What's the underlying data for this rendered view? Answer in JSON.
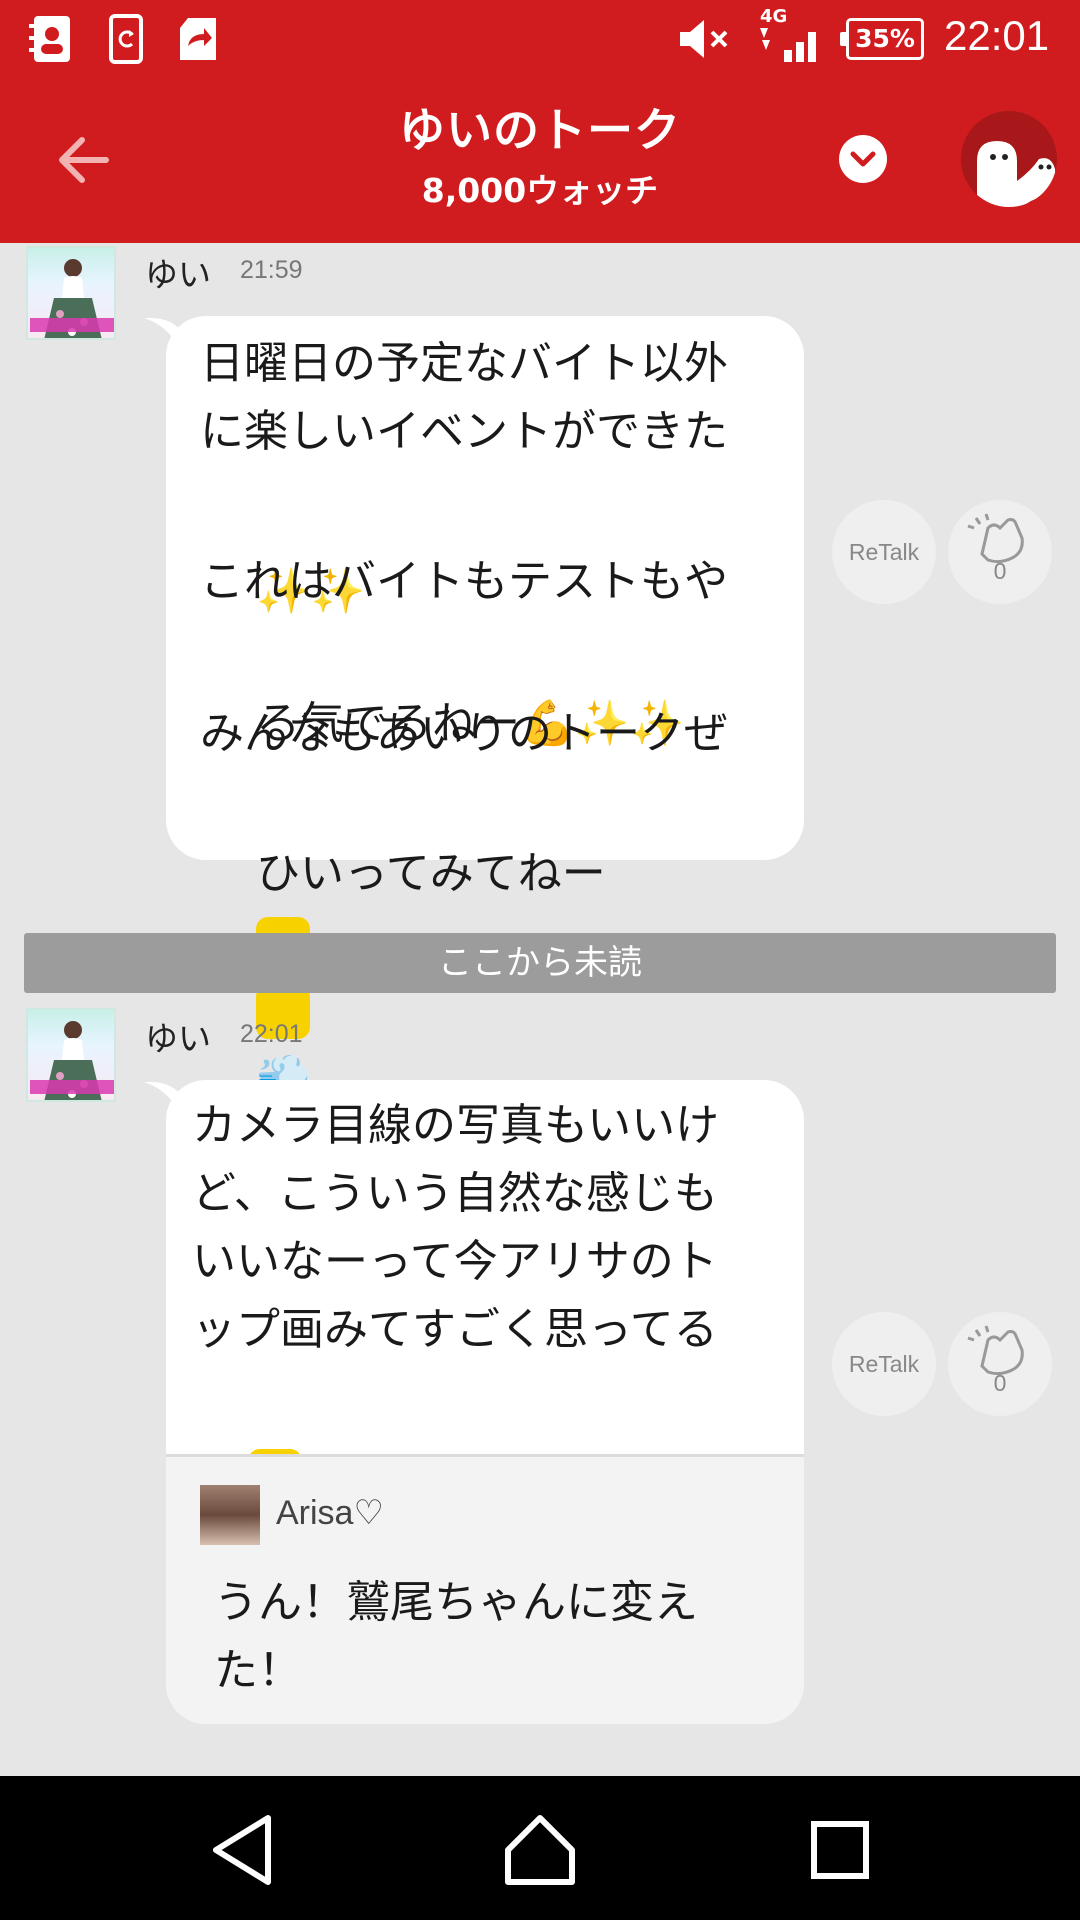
{
  "status_bar": {
    "battery": "35%",
    "time": "22:01",
    "network": "4G"
  },
  "header": {
    "title": "ゆいのトーク",
    "subtitle": "8,000ウォッチ"
  },
  "messages": [
    {
      "sender": "ゆい",
      "time": "21:59",
      "text_lines": [
        "日曜日の予定なバイト以外",
        "に楽しいイベントができた",
        "",
        "これはバイトもテストもや",
        "る気でるねー",
        "みんなもあいりのトークぜ",
        "ひいってみてねー"
      ],
      "retalk_label": "ReTalk",
      "clap_count": "0"
    },
    {
      "sender": "ゆい",
      "time": "22:01",
      "text_lines": [
        "カメラ目線の写真もいいけ",
        "ど、こういう自然な感じも",
        "いいなーって今アリサのト",
        "ップ画みてすごく思ってる"
      ],
      "retalk_label": "ReTalk",
      "clap_count": "0",
      "quote": {
        "name": "Arisa♡",
        "text": "うん！鷲尾ちゃんに変えた！"
      }
    }
  ],
  "unread_divider": "ここから未読",
  "icons": {
    "back": "arrow-left-icon",
    "dropdown": "chevron-down-icon",
    "profile": "ghost-character-icon",
    "clap": "clap-hands-icon",
    "nav_back": "triangle-back-icon",
    "nav_home": "home-icon",
    "nav_recents": "square-recents-icon"
  },
  "colors": {
    "brand_red": "#d11c1f",
    "background": "#e6e6e6",
    "unread_bar": "#9c9c9c"
  }
}
